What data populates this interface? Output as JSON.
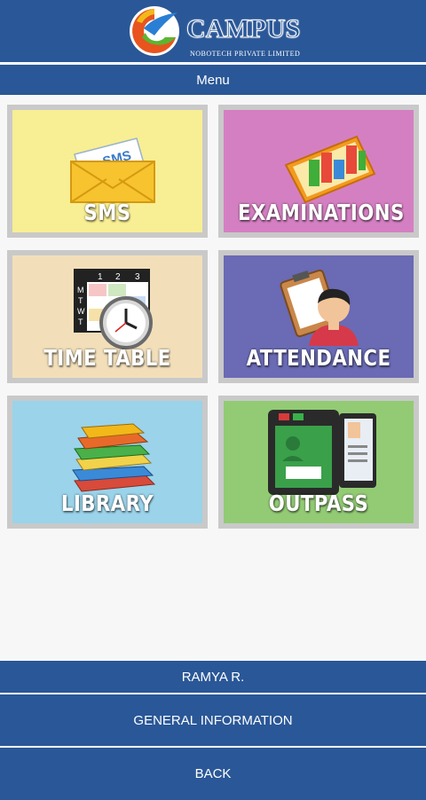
{
  "app": {
    "logo_text": "CAMPUS",
    "logo_subtext": "NOBOTECH PRIVATE LIMITED",
    "menu_title": "Menu"
  },
  "colors": {
    "primary": "#2a5797",
    "sms_bg": "#f8ee93",
    "exam_bg": "#d57fc3",
    "timetable_bg": "#f2dfba",
    "attendance_bg": "#6a6ab5",
    "library_bg": "#9ad3ea",
    "outpass_bg": "#92cb74"
  },
  "tiles": [
    {
      "label": "SMS",
      "icon": "sms-envelope-icon"
    },
    {
      "label": "EXAMINATIONS",
      "icon": "bar-chart-icon"
    },
    {
      "label": "TIME TABLE",
      "icon": "timetable-clock-icon"
    },
    {
      "label": "ATTENDANCE",
      "icon": "clipboard-person-icon"
    },
    {
      "label": "LIBRARY",
      "icon": "books-icon"
    },
    {
      "label": "OUTPASS",
      "icon": "id-card-reader-icon"
    }
  ],
  "timetable_icon": {
    "numbers": [
      "1",
      "2",
      "3"
    ],
    "days": [
      "M",
      "T",
      "W",
      "T"
    ]
  },
  "sms_icon_text": "SMS",
  "footer": {
    "user_name": "RAMYA R.",
    "general_info": "GENERAL INFORMATION",
    "back": "BACK"
  }
}
